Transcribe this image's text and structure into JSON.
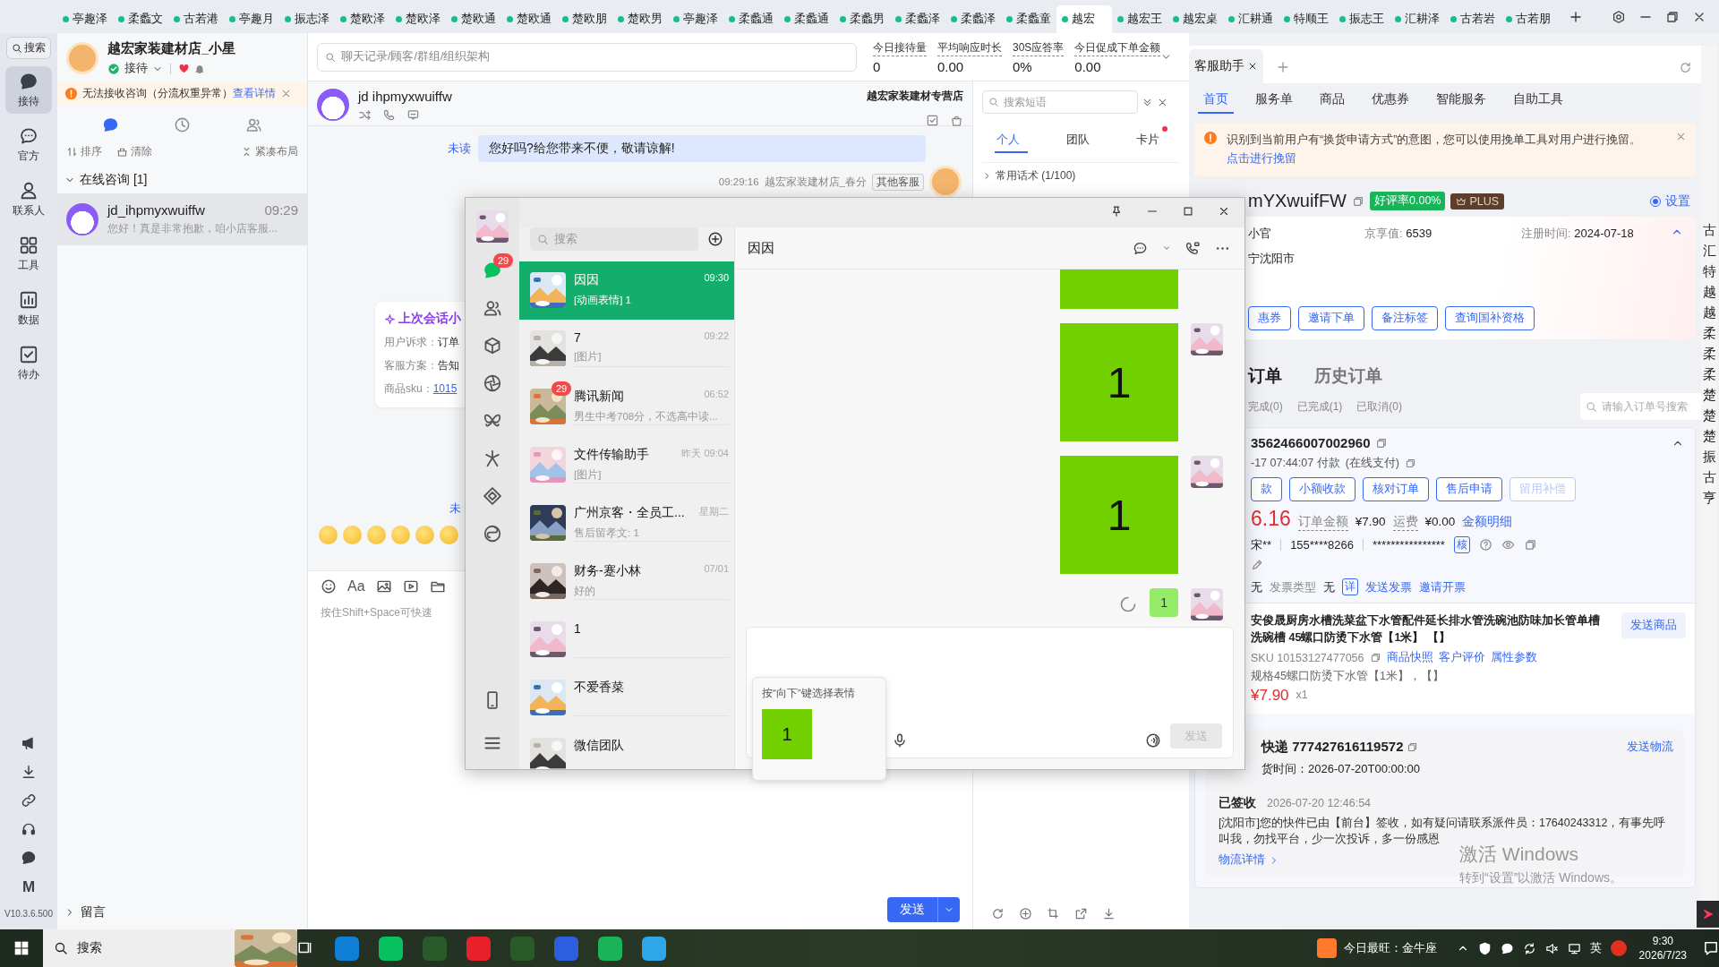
{
  "top_tabs": [
    {
      "label": "亭趣泽",
      "selected": false
    },
    {
      "label": "柔蠡文",
      "selected": false
    },
    {
      "label": "古若港",
      "selected": false
    },
    {
      "label": "亭趣月",
      "selected": false
    },
    {
      "label": "振志泽",
      "selected": false
    },
    {
      "label": "楚欧泽",
      "selected": false
    },
    {
      "label": "楚欧泽",
      "selected": false
    },
    {
      "label": "楚欧通",
      "selected": false
    },
    {
      "label": "楚欧通",
      "selected": false
    },
    {
      "label": "楚欧朋",
      "selected": false
    },
    {
      "label": "楚欧男",
      "selected": false
    },
    {
      "label": "亭趣泽",
      "selected": false
    },
    {
      "label": "柔蠡通",
      "selected": false
    },
    {
      "label": "柔蠡通",
      "selected": false
    },
    {
      "label": "柔蠡男",
      "selected": false
    },
    {
      "label": "柔蠡泽",
      "selected": false
    },
    {
      "label": "柔蠡泽",
      "selected": false
    },
    {
      "label": "柔蠡童",
      "selected": false
    },
    {
      "label": "越宏",
      "selected": true
    },
    {
      "label": "越宏王",
      "selected": false
    },
    {
      "label": "越宏桌",
      "selected": false
    },
    {
      "label": "汇耕通",
      "selected": false
    },
    {
      "label": "特顺王",
      "selected": false
    },
    {
      "label": "振志王",
      "selected": false
    },
    {
      "label": "汇耕泽",
      "selected": false
    },
    {
      "label": "古若岩",
      "selected": false
    },
    {
      "label": "古若朋",
      "selected": false
    }
  ],
  "rail": {
    "search": "搜索",
    "items": [
      {
        "label": "接待",
        "selected": true
      },
      {
        "label": "官方",
        "selected": false
      },
      {
        "label": "联系人",
        "selected": false
      },
      {
        "label": "工具",
        "selected": false
      },
      {
        "label": "数据",
        "selected": false
      },
      {
        "label": "待办",
        "selected": false
      }
    ],
    "letter": "M",
    "version": "V10.3.6.500"
  },
  "session_panel": {
    "shop_name": "越宏家装建材店_小星",
    "status": "接待",
    "alert": {
      "text": "无法接收咨询（分流权重异常）",
      "link": "查看详情"
    },
    "view_tabs": [
      {
        "selected": true
      },
      {
        "selected": false
      },
      {
        "selected": false
      }
    ],
    "actions": [
      "排序",
      "清除",
      "紧凑布局"
    ],
    "group": {
      "label": "在线咨询 [1]",
      "expanded": true
    },
    "sessions": [
      {
        "name": "jd_ihpmyxwuiffw",
        "time": "09:29",
        "preview": "您好！真是非常抱歉，咱小店客服...",
        "selected": true
      }
    ],
    "footer": {
      "label": "留言",
      "expanded": false
    }
  },
  "chat": {
    "search_placeholder": "聊天记录/顾客/群组/组织架构",
    "stats": [
      {
        "label": "今日接待量",
        "value": "0"
      },
      {
        "label": "平均响应时长",
        "value": "0.00"
      },
      {
        "label": "30S应答率",
        "value": "0%"
      },
      {
        "label": "今日促成下单金额",
        "value": "0.00"
      }
    ],
    "customer": "jd ihpmyxwuiffw",
    "store": "越宏家装建材专营店",
    "reply": {
      "unread": "未读",
      "text": "您好吗?给您带来不便，敬请谅解!"
    },
    "meta": {
      "time": "09:29:16",
      "agent": "越宏家装建材店_春分",
      "tag": "其他客服"
    },
    "summary": {
      "title": "上次会话小",
      "rows": [
        {
          "label": "用户诉求：",
          "value": "订单",
          "link": false
        },
        {
          "label": "客服方案：",
          "value": "告知",
          "link": false
        },
        {
          "label": "商品sku：",
          "value": "1015",
          "link": true
        }
      ]
    },
    "unread_mark": "未",
    "font_tool": "Aa",
    "input_placeholder": "按住Shift+Space可快速",
    "send": "发送"
  },
  "phrases": {
    "search_placeholder": "搜索短语",
    "tabs": [
      {
        "label": "个人",
        "selected": true,
        "unread": false
      },
      {
        "label": "团队",
        "selected": false,
        "unread": false
      },
      {
        "label": "卡片",
        "selected": false,
        "unread": true
      }
    ],
    "folders": [
      {
        "label": "常用话术 (1/100)",
        "expanded": false
      }
    ]
  },
  "assistant": {
    "tab": "客服助手",
    "nav": [
      {
        "label": "首页",
        "selected": true
      },
      {
        "label": "服务单",
        "selected": false
      },
      {
        "label": "商品",
        "selected": false
      },
      {
        "label": "优惠券",
        "selected": false
      },
      {
        "label": "智能服务",
        "selected": false
      },
      {
        "label": "自助工具",
        "selected": false
      }
    ],
    "alert": {
      "text": "识别到当前用户有“换货申请方式”的意图，您可以使用挽单工具对用户进行挽留。",
      "link": "点击进行挽留"
    },
    "customer": {
      "name": "mYXwuifFW",
      "rating": "好评率0.00%",
      "member": "PLUS",
      "settings": {
        "label": "设置",
        "selected": true
      },
      "level": "小官",
      "jd_value_label": "京享值:",
      "jd_value": "6539",
      "reg_label": "注册时间:",
      "reg_date": "2024-07-18",
      "city": "宁沈阳市"
    },
    "actions": [
      {
        "label": "惠券",
        "disabled": false
      },
      {
        "label": "邀请下单",
        "disabled": false
      },
      {
        "label": "备注标签",
        "disabled": false
      },
      {
        "label": "查询国补资格",
        "disabled": false
      }
    ],
    "order_tabs": [
      {
        "label": "订单",
        "selected": true
      },
      {
        "label": "历史订单",
        "selected": false
      }
    ],
    "filters": [
      "完成(0)",
      "已完成(1)",
      "已取消(0)"
    ],
    "order_search": "请输入订单号搜索",
    "order": {
      "id": "3562466007002960",
      "paid": "-17 07:44:07 付款",
      "pay_method": "(在线支付)",
      "buttons": [
        {
          "label": "款",
          "disabled": false
        },
        {
          "label": "小额收款",
          "disabled": false
        },
        {
          "label": "核对订单",
          "disabled": false
        },
        {
          "label": "售后申请",
          "disabled": false
        },
        {
          "label": "留用补偿",
          "disabled": true
        }
      ],
      "total": "6.16",
      "amount_label": "订单金额",
      "amount": "¥7.90",
      "freight_label": "运费",
      "freight": "¥0.00",
      "detail_link": "金额明细",
      "receiver": "宋**",
      "phone": "155****8266",
      "address": "****************",
      "verify": "核",
      "invoice": {
        "value": "无",
        "type_label": "发票类型",
        "type": "无",
        "detail": "详",
        "send": "发送发票",
        "invite": "邀请开票"
      },
      "product": {
        "title": "安俊晟厨房水槽洗菜盆下水管配件延长排水管洗碗池防味加长管单槽洗碗槽 45螺口防烫下水管【1米】 【】",
        "sku": "SKU 10153127477056",
        "links": [
          "商品快照",
          "客户评价",
          "属性参数"
        ],
        "spec": "规格45螺口防烫下水管【1米】，【】",
        "price": "¥7.90",
        "qty": "x1",
        "send": "发送商品"
      },
      "logistics": {
        "carrier": "快递",
        "number": "777427616119572",
        "send": "发送物流",
        "deadline": "货时间：2026-07-20T00:00:00",
        "status": "已签收",
        "time": "2026-07-20 12:46:54",
        "detail": "[沈阳市]您的快件已由【前台】签收，如有疑问请联系派件员：17640243312，有事先呼叫我，勿找平台，少一次投诉，多一份感恩",
        "link": "物流详情"
      }
    }
  },
  "edge_strip": [
    "古",
    "汇",
    "特",
    "越",
    "越",
    "柔",
    "柔",
    "柔",
    "楚",
    "楚",
    "楚",
    "振",
    "古",
    "亨"
  ],
  "wechat": {
    "unread_badge": "29",
    "search_placeholder": "搜索",
    "chats": [
      {
        "name": "因因",
        "time": "09:30",
        "preview": "[动画表情] 1",
        "selected": true
      },
      {
        "name": "7",
        "time": "09:22",
        "preview": "[图片]",
        "selected": false
      },
      {
        "name": "腾讯新闻",
        "time": "06:52",
        "preview": "男生中考708分，不选高中读...",
        "selected": false,
        "badge": "29"
      },
      {
        "name": "文件传输助手",
        "time": "昨天 09:04",
        "preview": "[图片]",
        "selected": false
      },
      {
        "name": "广州京客・全员工...",
        "time": "星期二",
        "preview": "售后留孝文: 1",
        "selected": false
      },
      {
        "name": "财务-蹇小林",
        "time": "07/01",
        "preview": "好的",
        "selected": false
      },
      {
        "name": "1",
        "selected": false
      },
      {
        "name": "不爱香菜",
        "selected": false
      },
      {
        "name": "微信团队",
        "selected": false
      }
    ],
    "chat_title": "因因",
    "messages": [
      {
        "kind": "sticker_cut"
      },
      {
        "kind": "sticker",
        "text": "1"
      },
      {
        "kind": "sticker",
        "text": "1"
      },
      {
        "kind": "text",
        "text": "1",
        "sending": true
      }
    ],
    "send": {
      "label": "发送",
      "disabled": true
    },
    "popup": {
      "hint": "按“向下”键选择表情",
      "sticker": "1"
    }
  },
  "taskbar": {
    "search": "搜索",
    "weather": "今日最旺：金牛座",
    "ime": "英",
    "time": "9:30",
    "date": "2026/7/23"
  },
  "activation": {
    "title": "激活 Windows",
    "subtitle": "转到“设置”以激活 Windows。"
  }
}
